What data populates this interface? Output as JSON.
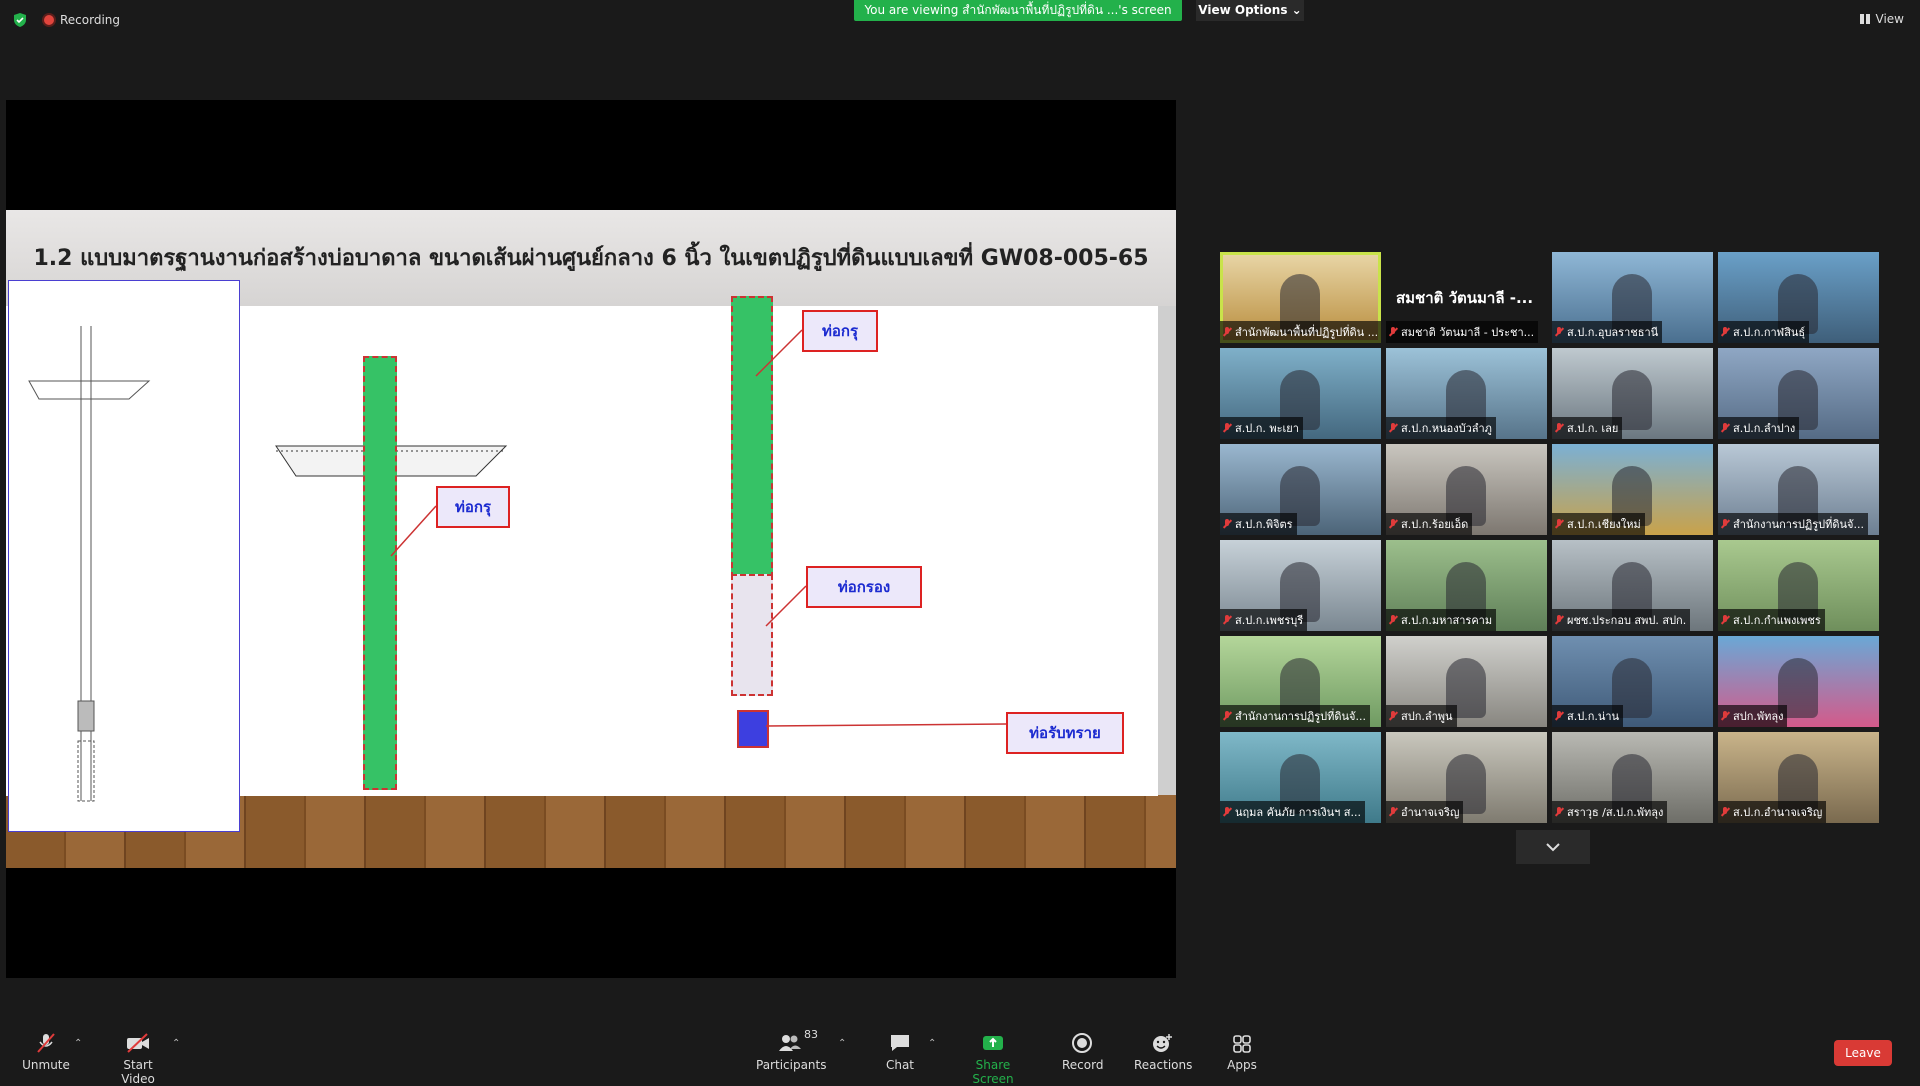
{
  "topbar": {
    "recording_label": "Recording",
    "viewing_text": "You are viewing สำนักพัฒนาพื้นที่ปฏิรูปที่ดิน ...'s screen",
    "view_options_label": "View Options ⌄",
    "view_label": "View"
  },
  "slide": {
    "title": "1.2 แบบมาตรฐานงานก่อสร้างบ่อบาดาล ขนาดเส้นผ่านศูนย์กลาง 6 นิ้ว ในเขตปฏิรูปที่ดินแบบเลขที่ GW08-005-65",
    "labels": {
      "pipe1": "ท่อกรุ",
      "pipe2": "ท่อกรุ",
      "screen": "ท่อกรอง",
      "sand": "ท่อรับทราย"
    }
  },
  "gallery": {
    "big_name": "สมชาติ วัตนมาลี -...",
    "tiles": [
      "สำนักพัฒนาพื้นที่ปฏิรูปที่ดิน ...",
      "สมชาติ วัตนมาลี - ประชา...",
      "ส.ป.ก.อุบลราชธานี",
      "ส.ป.ก.กาฬสินธุ์",
      "ส.ป.ก. พะเยา",
      "ส.ป.ก.หนองบัวลำภู",
      "ส.ป.ก. เลย",
      "ส.ป.ก.ลำปาง",
      "ส.ป.ก.พิจิตร",
      "ส.ป.ก.ร้อยเอ็ด",
      "ส.ป.ก.เชียงใหม่",
      "สำนักงานการปฏิรูปที่ดินจั...",
      "ส.ป.ก.เพชรบุรี",
      "ส.ป.ก.มหาสารคาม",
      "ผชช.ประกอบ สพป. สปก.",
      "ส.ป.ก.กำแพงเพชร",
      "สำนักงานการปฏิรูปที่ดินจั...",
      "สปก.ลำพูน",
      "ส.ป.ก.น่าน",
      "สปก.พัทลุง",
      "นฤมล คันภัย การเงินฯ ส...",
      "อำนาจเจริญ",
      "สราวุธ /ส.ป.ก.พัทลุง",
      "ส.ป.ก.อำนาจเจริญ"
    ]
  },
  "toolbar": {
    "unmute": "Unmute",
    "start_video": "Start Video",
    "participants": "Participants",
    "participants_count": "83",
    "chat": "Chat",
    "share_screen": "Share Screen",
    "record": "Record",
    "reactions": "Reactions",
    "apps": "Apps",
    "leave": "Leave"
  },
  "colors": {
    "share_green": "#23b14b",
    "leave_red": "#d93a35",
    "active_speaker": "#c9e34a"
  }
}
